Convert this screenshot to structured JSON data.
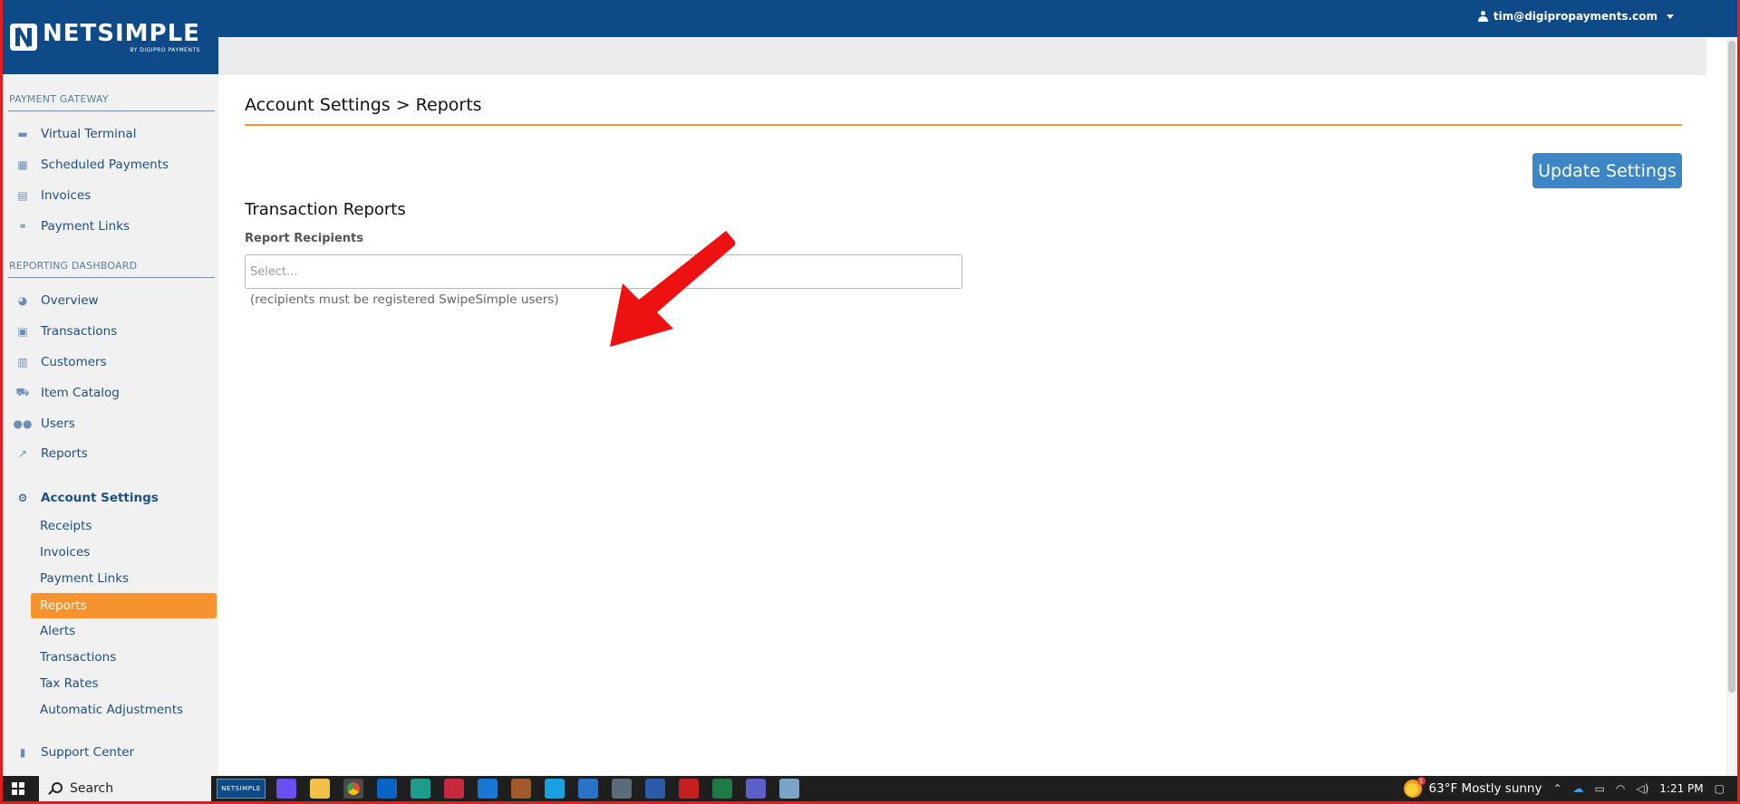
{
  "brand": {
    "name": "NETSIMPLE",
    "tagline": "BY DIGIPRO PAYMENTS",
    "color": "#0e4a87"
  },
  "header": {
    "user_email": "tim@digipropayments.com"
  },
  "sidebar": {
    "payment_gateway": {
      "label": "PAYMENT GATEWAY",
      "items": [
        {
          "label": "Virtual Terminal",
          "icon": "credit-card-icon"
        },
        {
          "label": "Scheduled Payments",
          "icon": "calendar-icon"
        },
        {
          "label": "Invoices",
          "icon": "document-icon"
        },
        {
          "label": "Payment Links",
          "icon": "link-icon"
        }
      ]
    },
    "reporting_dashboard": {
      "label": "REPORTING DASHBOARD",
      "items": [
        {
          "label": "Overview",
          "icon": "gauge-icon"
        },
        {
          "label": "Transactions",
          "icon": "money-icon"
        },
        {
          "label": "Customers",
          "icon": "id-card-icon"
        },
        {
          "label": "Item Catalog",
          "icon": "cart-icon"
        },
        {
          "label": "Users",
          "icon": "users-icon"
        },
        {
          "label": "Reports",
          "icon": "line-chart-icon"
        }
      ]
    },
    "account_settings": {
      "label": "Account Settings",
      "icon": "gear-icon",
      "items": [
        {
          "label": "Receipts"
        },
        {
          "label": "Invoices"
        },
        {
          "label": "Payment Links"
        },
        {
          "label": "Reports",
          "active": true
        },
        {
          "label": "Alerts"
        },
        {
          "label": "Transactions"
        },
        {
          "label": "Tax Rates"
        },
        {
          "label": "Automatic Adjustments"
        }
      ]
    },
    "support": {
      "label": "Support Center",
      "icon": "book-icon"
    }
  },
  "main": {
    "breadcrumb": "Account Settings > Reports",
    "update_button": "Update Settings",
    "section_title": "Transaction Reports",
    "field_label": "Report Recipients",
    "field_placeholder": "Select...",
    "field_help": "(recipients must be registered SwipeSimple users)"
  },
  "colors": {
    "accent": "#f7932e",
    "button": "#3d86c6",
    "nav_text": "#1d4f86"
  },
  "taskbar": {
    "search_label": "Search",
    "netsimple_label": "NETSIMPLE",
    "weather": "63°F  Mostly sunny",
    "weather_badge": "1",
    "time": "1:21 PM"
  }
}
